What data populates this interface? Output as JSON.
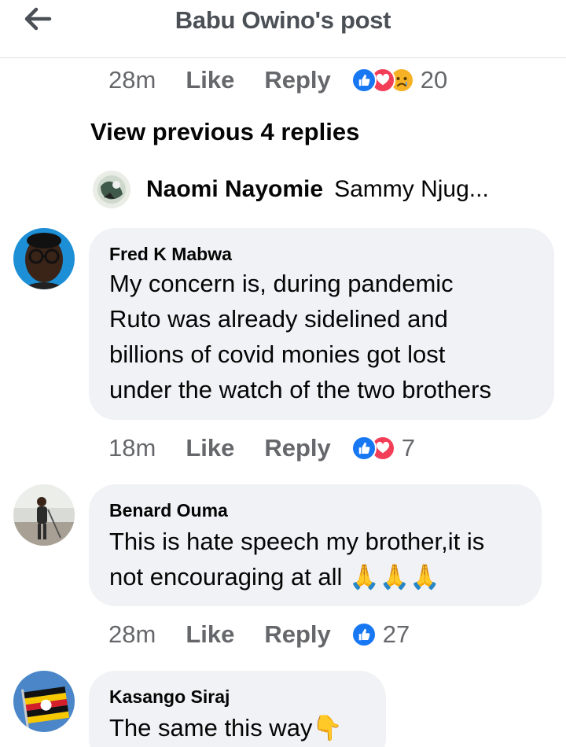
{
  "header": {
    "title": "Babu Owino's post"
  },
  "top_meta": {
    "time": "28m",
    "like": "Like",
    "reply": "Reply",
    "reaction_count": "20",
    "reactions": [
      "like-icon",
      "love-icon",
      "sad-icon"
    ]
  },
  "view_previous": "View previous 4 replies",
  "reply_preview": {
    "name": "Naomi Nayomie",
    "snippet": "Sammy Njug..."
  },
  "comments": [
    {
      "author": "Fred K Mabwa",
      "lines": [
        "My concern is, during pandemic",
        "Ruto was already sidelined and",
        "billions of covid monies got lost",
        "under the watch of the two brothers"
      ],
      "time": "18m",
      "like": "Like",
      "reply": "Reply",
      "reaction_count": "7",
      "reactions": [
        "like-icon",
        "love-icon"
      ]
    },
    {
      "author": "Benard Ouma",
      "lines": [
        "This is hate speech my brother,it is",
        "not encouraging at all 🙏🙏🙏"
      ],
      "time": "28m",
      "like": "Like",
      "reply": "Reply",
      "reaction_count": "27",
      "reactions": [
        "like-icon"
      ]
    },
    {
      "author": "Kasango Siraj",
      "lines": [
        "The same this way👇"
      ]
    }
  ],
  "colors": {
    "secondary_text": "#65676b",
    "bubble": "#f0f2f5",
    "like_blue": "#1877f2",
    "love_red": "#f33e58",
    "sad_yellow": "#f7b125"
  }
}
